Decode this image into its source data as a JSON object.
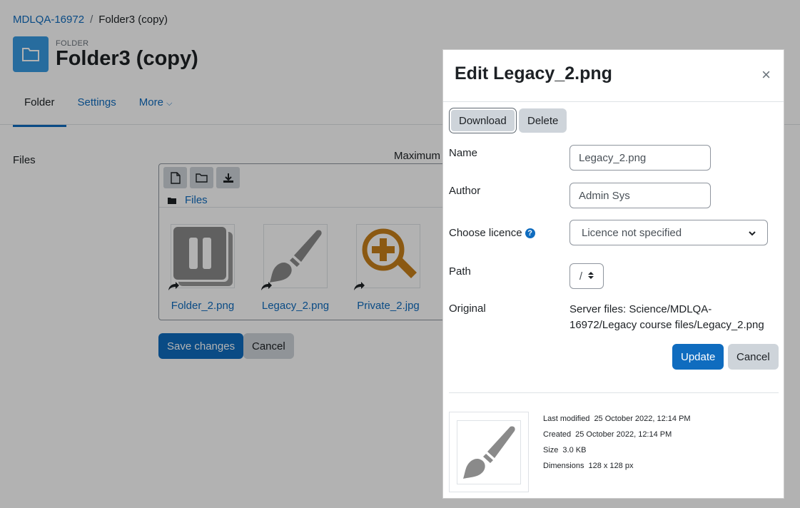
{
  "breadcrumb": {
    "course": "MDLQA-16972",
    "separator": "/",
    "current": "Folder3 (copy)"
  },
  "header": {
    "kicker": "FOLDER",
    "title": "Folder3 (copy)"
  },
  "tabs": [
    {
      "label": "Folder"
    },
    {
      "label": "Settings"
    },
    {
      "label": "More"
    }
  ],
  "form": {
    "files_label": "Files",
    "maximum_text": "Maximum",
    "path_label": "Files",
    "files": [
      {
        "name": "Folder_2.png",
        "icon": "pause-stack-icon"
      },
      {
        "name": "Legacy_2.png",
        "icon": "paintbrush-icon"
      },
      {
        "name": "Private_2.jpg",
        "icon": "magnifier-plus-icon"
      }
    ],
    "save_label": "Save changes",
    "cancel_label": "Cancel"
  },
  "dialog": {
    "title": "Edit Legacy_2.png",
    "close_glyph": "×",
    "download_label": "Download",
    "delete_label": "Delete",
    "name_label": "Name",
    "name_value": "Legacy_2.png",
    "author_label": "Author",
    "author_value": "Admin Sys",
    "licence_label": "Choose licence",
    "licence_value": "Licence not specified",
    "path_label": "Path",
    "path_value": "/",
    "original_label": "Original",
    "original_value": "Server files: Science/MDLQA-16972/Legacy course files/Legacy_2.png",
    "update_label": "Update",
    "cancel_label": "Cancel",
    "meta": {
      "modified_key": "Last modified",
      "modified_val": "25 October 2022, 12:14 PM",
      "created_key": "Created",
      "created_val": "25 October 2022, 12:14 PM",
      "size_key": "Size",
      "size_val": "3.0 KB",
      "dim_key": "Dimensions",
      "dim_val": "128 x 128 px"
    }
  },
  "colors": {
    "primary": "#0f6cbf",
    "secondary": "#ced4da",
    "folder_icon_bg": "#399be2",
    "magnifier": "#c8801a"
  }
}
